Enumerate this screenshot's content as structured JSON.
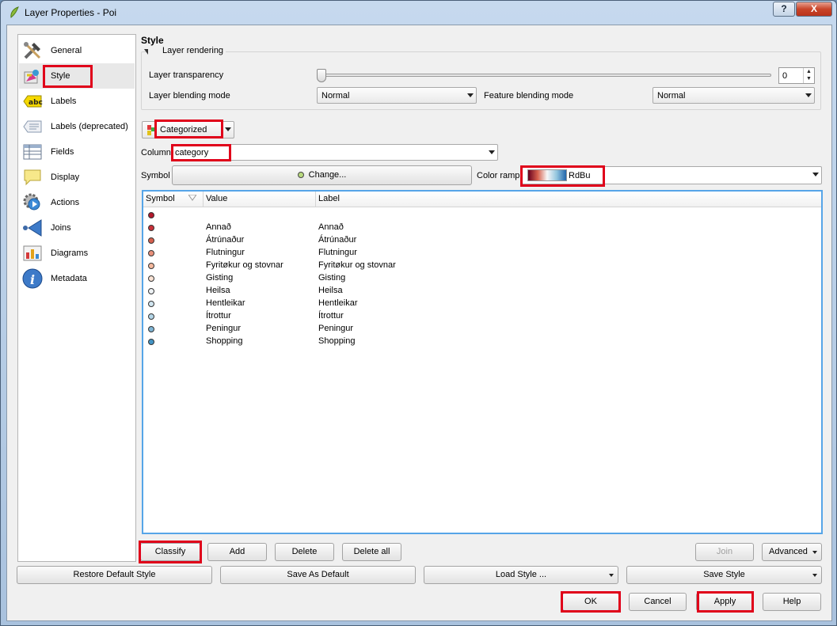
{
  "window": {
    "title": "Layer Properties - Poi",
    "help_glyph": "?",
    "close_glyph": "X"
  },
  "sidebar": {
    "items": [
      {
        "label": "General",
        "icon": "wrench-hammer-icon"
      },
      {
        "label": "Style",
        "icon": "paint-style-icon"
      },
      {
        "label": "Labels",
        "icon": "abc-label-icon"
      },
      {
        "label": "Labels (deprecated)",
        "icon": "label-deprecated-icon"
      },
      {
        "label": "Fields",
        "icon": "table-fields-icon"
      },
      {
        "label": "Display",
        "icon": "speech-bubble-icon"
      },
      {
        "label": "Actions",
        "icon": "gear-play-icon"
      },
      {
        "label": "Joins",
        "icon": "join-arrow-icon"
      },
      {
        "label": "Diagrams",
        "icon": "diagram-icon"
      },
      {
        "label": "Metadata",
        "icon": "info-icon"
      }
    ],
    "selected": "Style"
  },
  "style": {
    "heading": "Style",
    "layer_rendering": {
      "title": "Layer rendering",
      "transparency_label": "Layer transparency",
      "transparency_value": "0",
      "transparency_level": 0,
      "blending_label": "Layer blending mode",
      "blending_value": "Normal",
      "feature_blending_label": "Feature blending mode",
      "feature_blending_value": "Normal"
    },
    "renderer": "Categorized",
    "column_label": "Column",
    "column_value": "category",
    "symbol_label": "Symbol",
    "change_button": "Change...",
    "color_ramp_label": "Color ramp",
    "color_ramp_value": "RdBu"
  },
  "table": {
    "headers": [
      "Symbol",
      "Value",
      "Label"
    ],
    "rows": [
      {
        "color": "#b2182b",
        "value": "",
        "label": ""
      },
      {
        "color": "#c8303a",
        "value": "Annað",
        "label": "Annað"
      },
      {
        "color": "#d6604d",
        "value": "Átrúnaður",
        "label": "Átrúnaður"
      },
      {
        "color": "#e8907a",
        "value": "Flutningur",
        "label": "Flutningur"
      },
      {
        "color": "#f4b89d",
        "value": "Fyritøkur og stovnar",
        "label": "Fyritøkur og stovnar"
      },
      {
        "color": "#f8e2d4",
        "value": "Gisting",
        "label": "Gisting"
      },
      {
        "color": "#eef2f5",
        "value": "Heilsa",
        "label": "Heilsa"
      },
      {
        "color": "#d1e5f0",
        "value": "Hentleikar",
        "label": "Hentleikar"
      },
      {
        "color": "#b3d5e7",
        "value": "Ítrottur",
        "label": "Ítrottur"
      },
      {
        "color": "#7fb4d4",
        "value": "Peningur",
        "label": "Peningur"
      },
      {
        "color": "#4393c3",
        "value": "Shopping",
        "label": "Shopping"
      }
    ]
  },
  "buttons": {
    "classify": "Classify",
    "add": "Add",
    "delete": "Delete",
    "delete_all": "Delete all",
    "join": "Join",
    "advanced": "Advanced",
    "restore_default": "Restore Default Style",
    "save_as_default": "Save As Default",
    "load_style": "Load Style ...",
    "save_style": "Save Style",
    "ok": "OK",
    "cancel": "Cancel",
    "apply": "Apply",
    "help": "Help"
  },
  "highlight_color": "#e0001a"
}
